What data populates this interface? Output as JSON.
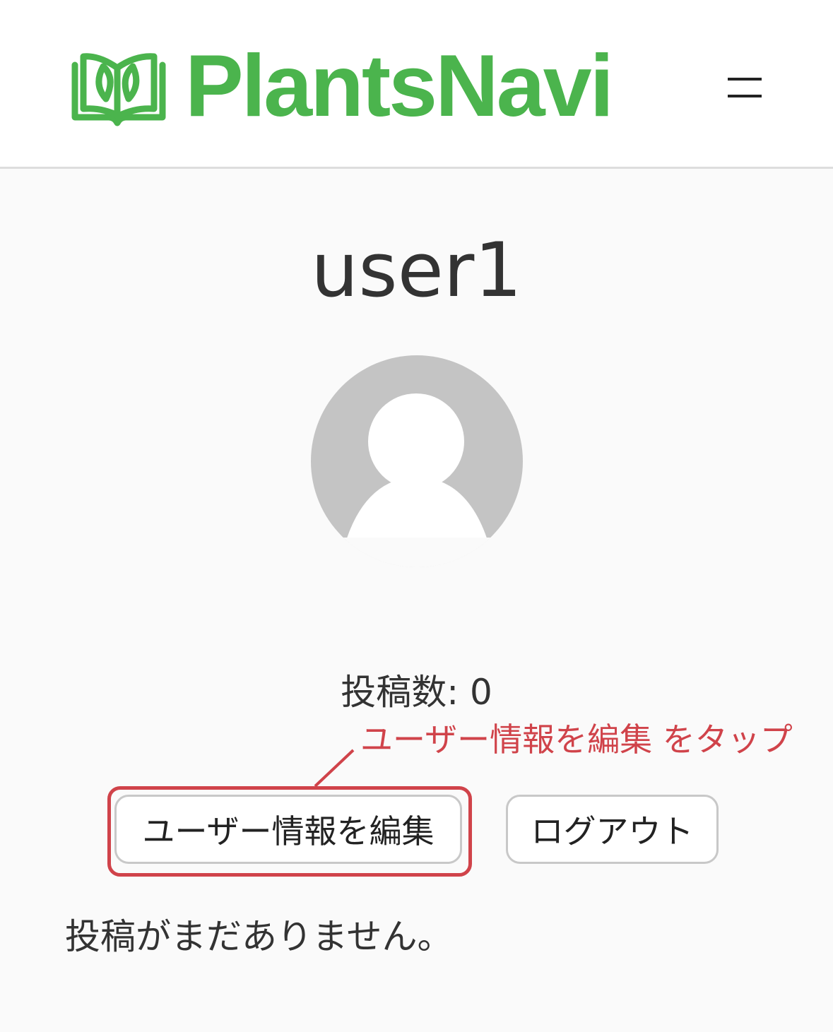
{
  "colors": {
    "brand_green": "#4bb44d",
    "annotation_red": "#d0434a",
    "avatar_gray": "#c4c4c4"
  },
  "header": {
    "logo_text": "PlantsNavi",
    "logo_icon": "open-book-leaf-icon",
    "menu_icon": "hamburger-menu-icon"
  },
  "profile": {
    "username": "user1",
    "avatar_icon": "default-user-avatar-icon",
    "post_count_label": "投稿数: 0"
  },
  "annotation": {
    "text": "ユーザー情報を編集 をタップ"
  },
  "actions": {
    "edit_label": "ユーザー情報を編集",
    "logout_label": "ログアウト"
  },
  "posts": {
    "empty_message": "投稿がまだありません。"
  }
}
